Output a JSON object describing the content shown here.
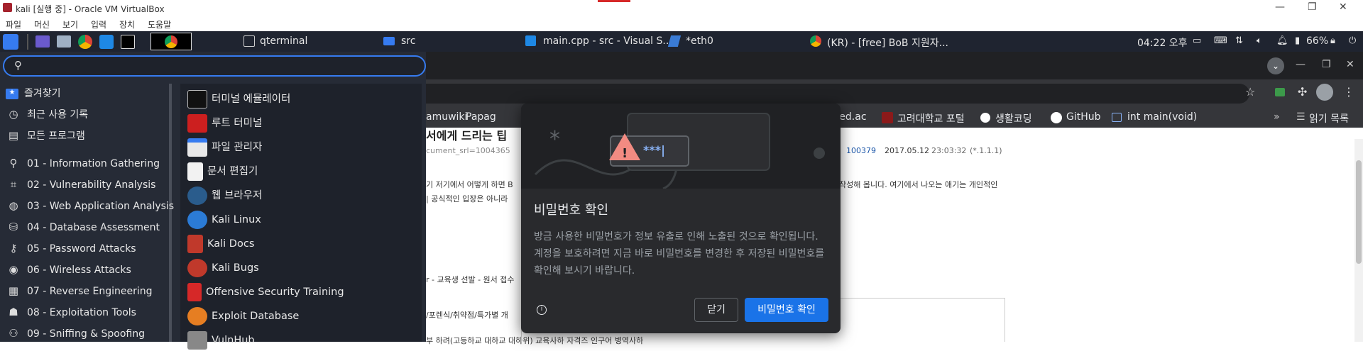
{
  "vbox": {
    "title": "kali [실행 중] - Oracle VM VirtualBox",
    "menu": [
      "파일",
      "머신",
      "보기",
      "입력",
      "장치",
      "도움말"
    ]
  },
  "taskbar": {
    "tasks": [
      "qterminal",
      "src",
      "main.cpp - src - Visual S...",
      "*eth0",
      "(KR) - [free] BoB 지원자..."
    ],
    "clock": "04:22 오후",
    "battery": "66%"
  },
  "menu": {
    "categories": [
      {
        "label": "즐겨찾기",
        "icon": "star-icon"
      },
      {
        "label": "최근 사용 기록",
        "icon": "recent-icon"
      },
      {
        "label": "모든 프로그램",
        "icon": "folder-icon"
      },
      {
        "label": "01 - Information Gathering",
        "icon": "search-icon"
      },
      {
        "label": "02 - Vulnerability Analysis",
        "icon": "vulnerability-icon"
      },
      {
        "label": "03 - Web Application Analysis",
        "icon": "web-icon"
      },
      {
        "label": "04 - Database Assessment",
        "icon": "database-icon"
      },
      {
        "label": "05 - Password Attacks",
        "icon": "key-icon"
      },
      {
        "label": "06 - Wireless Attacks",
        "icon": "wireless-icon"
      },
      {
        "label": "07 - Reverse Engineering",
        "icon": "reverse-icon"
      },
      {
        "label": "08 - Exploitation Tools",
        "icon": "exploit-icon"
      },
      {
        "label": "09 - Sniffing & Spoofing",
        "icon": "sniff-icon"
      }
    ],
    "apps": [
      {
        "label": "터미널 에뮬레이터",
        "icon": "terminal-icon",
        "color": "#111111"
      },
      {
        "label": "루트 터미널",
        "icon": "root-terminal-icon",
        "color": "#cc1f1f"
      },
      {
        "label": "파일 관리자",
        "icon": "file-manager-icon",
        "color": "#e8e8e8"
      },
      {
        "label": "문서 편집기",
        "icon": "text-editor-icon",
        "color": "#f2f2f2"
      },
      {
        "label": "웹 브라우저",
        "icon": "globe-icon",
        "color": "#2a5c8c"
      },
      {
        "label": "Kali Linux",
        "icon": "kali-dragon-icon",
        "color": "#2b7bd6"
      },
      {
        "label": "Kali Docs",
        "icon": "kali-docs-icon",
        "color": "#c0392b"
      },
      {
        "label": "Kali Bugs",
        "icon": "bug-icon",
        "color": "#c0392b"
      },
      {
        "label": "Offensive Security Training",
        "icon": "offsec-icon",
        "color": "#d62828"
      },
      {
        "label": "Exploit Database",
        "icon": "spider-icon",
        "color": "#e67e22"
      },
      {
        "label": "VulnHub",
        "icon": "vulnhub-icon",
        "color": "#888888"
      }
    ]
  },
  "browser": {
    "bookmarks": [
      "amuwiki",
      "Papag",
      "ved.ac",
      "고려대학교 포털",
      "생활코딩",
      "GitHub",
      "int main(void)"
    ],
    "reading_list": "읽기 목록",
    "content": {
      "heading_partial": "서에게 드리는 팁",
      "doc_srl": "cument_srl=1004365",
      "meta_id": "100379",
      "meta_date": "2017.05.12",
      "meta_time": "23:03:32",
      "meta_ip": "(*.1.1.1)",
      "para1_left": "기 저기에서 어떻게 하면 B",
      "para1_right": "작성해 봅니다. 여기에서 나오는 애기는 개인적인",
      "para2_left": "| 공식적인 입장은 아니라",
      "line3": "r - 교육생 선발 - 원서 접수",
      "line4": "/포렌식/취약점/특가별 개",
      "line5": "부  하려(고등하교  대하교  대하위)  교육사하  자격즈  인구어  병역사하"
    }
  },
  "dialog": {
    "title": "비밀번호 확인",
    "body": "방금 사용한 비밀번호가 정보 유출로 인해 노출된 것으로 확인됩니다. 계정을 보호하려면 지금 바로 비밀번호를 변경한 후 저장된 비밀번호를 확인해 보시기 바랍니다.",
    "password_mask": "***|",
    "cancel": "닫기",
    "confirm": "비밀번호 확인"
  }
}
